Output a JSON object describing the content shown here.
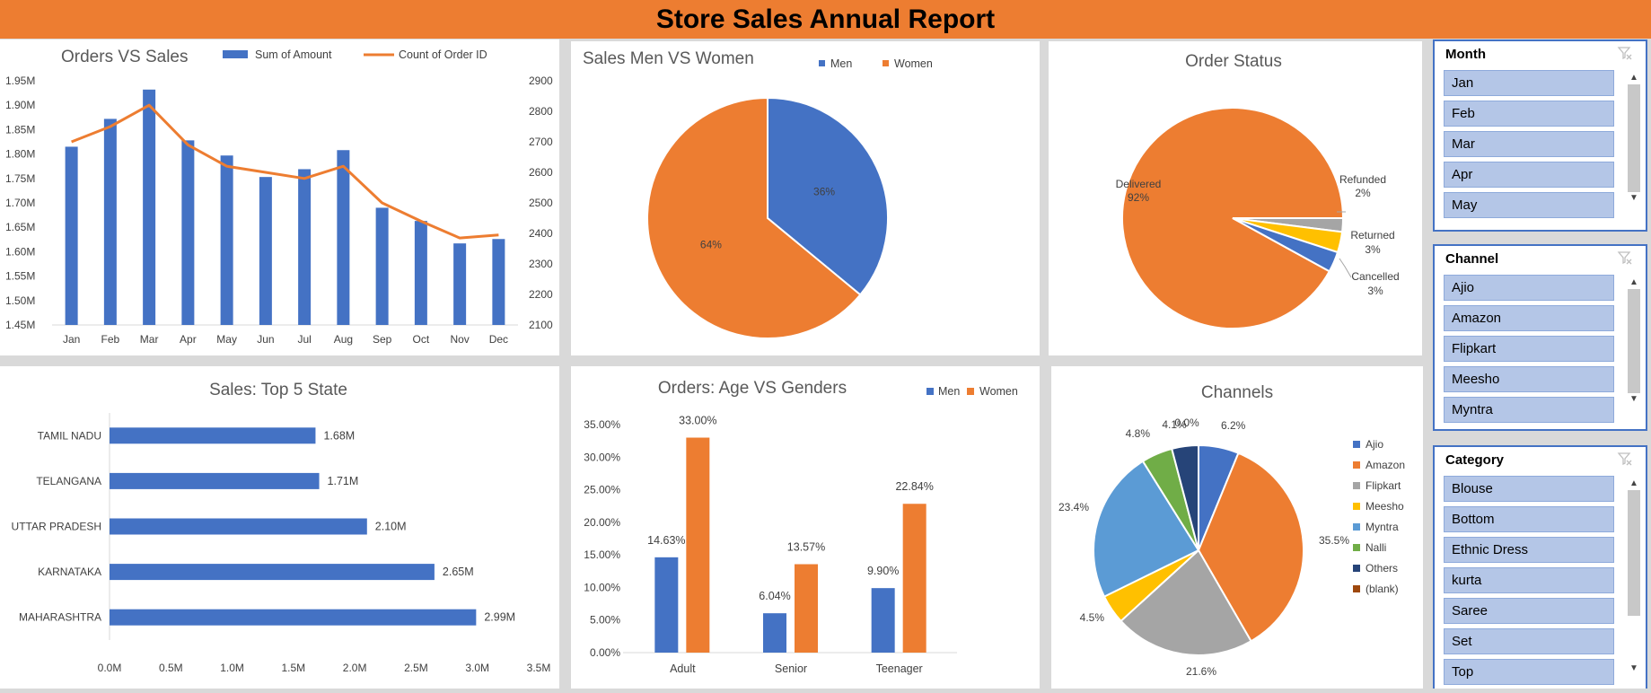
{
  "report": {
    "title": "Store Sales Annual Report"
  },
  "colors": {
    "blue": "#4472c4",
    "orange": "#ed7d31",
    "gray": "#a5a5a5",
    "yellow": "#ffc000",
    "lightblue": "#5b9bd5",
    "green": "#70ad47",
    "navy": "#264478",
    "red": "#9e480e"
  },
  "chart_data": [
    {
      "id": "orders-vs-sales",
      "type": "bar+line",
      "title": "Orders VS Sales",
      "categories": [
        "Jan",
        "Feb",
        "Mar",
        "Apr",
        "May",
        "Jun",
        "Jul",
        "Aug",
        "Sep",
        "Oct",
        "Nov",
        "Dec"
      ],
      "series": [
        {
          "name": "Sum of Amount",
          "type": "bar",
          "axis": "left",
          "values": [
            1.815,
            1.872,
            1.932,
            1.828,
            1.797,
            1.753,
            1.769,
            1.808,
            1.69,
            1.663,
            1.617,
            1.626
          ]
        },
        {
          "name": "Count of Order ID",
          "type": "line",
          "axis": "right",
          "values": [
            2700,
            2750,
            2820,
            2690,
            2620,
            2600,
            2580,
            2620,
            2500,
            2440,
            2385,
            2395
          ]
        }
      ],
      "ylim": [
        1.45,
        1.95
      ],
      "y_ticks": [
        "1.45M",
        "1.50M",
        "1.55M",
        "1.60M",
        "1.65M",
        "1.70M",
        "1.75M",
        "1.80M",
        "1.85M",
        "1.90M",
        "1.95M"
      ],
      "y2lim": [
        2100,
        2900
      ],
      "y2_ticks": [
        "2100",
        "2200",
        "2300",
        "2400",
        "2500",
        "2600",
        "2700",
        "2800",
        "2900"
      ],
      "legend": "top"
    },
    {
      "id": "sales-men-women",
      "type": "pie",
      "title": "Sales Men VS Women",
      "labels": [
        "Men",
        "Women"
      ],
      "values": [
        36,
        64
      ],
      "data_labels": [
        "36%",
        "64%"
      ],
      "legend": "top"
    },
    {
      "id": "order-status",
      "type": "pie",
      "title": "Order Status",
      "labels": [
        "Delivered",
        "Refunded",
        "Returned",
        "Cancelled"
      ],
      "values": [
        92,
        2,
        3,
        3
      ],
      "data_labels": [
        "92%",
        "2%",
        "3%",
        "3%"
      ]
    },
    {
      "id": "top5-state",
      "type": "bar",
      "orientation": "horizontal",
      "title": "Sales: Top 5 State",
      "categories": [
        "TAMIL NADU",
        "TELANGANA",
        "UTTAR PRADESH",
        "KARNATAKA",
        "MAHARASHTRA"
      ],
      "values": [
        1.68,
        1.71,
        2.1,
        2.65,
        2.99
      ],
      "data_labels": [
        "1.68M",
        "1.71M",
        "2.10M",
        "2.65M",
        "2.99M"
      ],
      "xlim": [
        0,
        3.5
      ],
      "x_ticks": [
        "0.0M",
        "0.5M",
        "1.0M",
        "1.5M",
        "2.0M",
        "2.5M",
        "3.0M",
        "3.5M"
      ]
    },
    {
      "id": "age-vs-genders",
      "type": "bar",
      "title": "Orders: Age VS Genders",
      "categories": [
        "Adult",
        "Senior",
        "Teenager"
      ],
      "series": [
        {
          "name": "Men",
          "values": [
            14.63,
            6.04,
            9.9
          ],
          "data_labels": [
            "14.63%",
            "6.04%",
            "9.90%"
          ]
        },
        {
          "name": "Women",
          "values": [
            33.0,
            13.57,
            22.84
          ],
          "data_labels": [
            "33.00%",
            "13.57%",
            "22.84%"
          ]
        }
      ],
      "ylim": [
        0,
        35
      ],
      "y_ticks": [
        "0.00%",
        "5.00%",
        "10.00%",
        "15.00%",
        "20.00%",
        "25.00%",
        "30.00%",
        "35.00%"
      ],
      "legend": "top-right"
    },
    {
      "id": "channels",
      "type": "pie",
      "title": "Channels",
      "labels": [
        "Ajio",
        "Amazon",
        "Flipkart",
        "Meesho",
        "Myntra",
        "Nalli",
        "Others",
        "(blank)"
      ],
      "values": [
        6.2,
        35.5,
        21.6,
        4.5,
        23.4,
        4.8,
        4.1,
        0.0
      ],
      "data_labels": [
        "6.2%",
        "35.5%",
        "21.6%",
        "4.5%",
        "23.4%",
        "4.8%",
        "4.1%",
        "0.0%"
      ],
      "legend": "right"
    }
  ],
  "slicers": [
    {
      "title": "Month",
      "items": [
        "Jan",
        "Feb",
        "Mar",
        "Apr",
        "May"
      ]
    },
    {
      "title": "Channel",
      "items": [
        "Ajio",
        "Amazon",
        "Flipkart",
        "Meesho",
        "Myntra"
      ]
    },
    {
      "title": "Category",
      "items": [
        "Blouse",
        "Bottom",
        "Ethnic Dress",
        "kurta",
        "Saree",
        "Set",
        "Top"
      ]
    }
  ]
}
